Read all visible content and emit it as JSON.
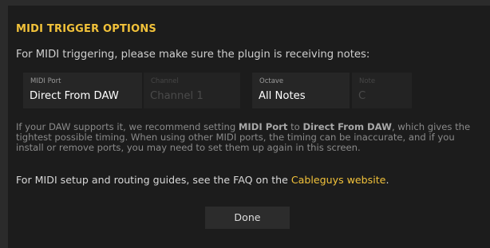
{
  "dialog": {
    "title": "MIDI TRIGGER OPTIONS",
    "intro": "For MIDI triggering, please make sure the plugin is receiving notes:"
  },
  "fields": {
    "midi_port": {
      "label": "MIDI Port",
      "value": "Direct From DAW"
    },
    "channel": {
      "label": "Channel",
      "value": "Channel 1"
    },
    "octave": {
      "label": "Octave",
      "value": "All Notes"
    },
    "note": {
      "label": "Note",
      "value": "C"
    }
  },
  "info": {
    "p1": "If your DAW supports it, we recommend setting ",
    "b1": "MIDI Port",
    "p2": " to ",
    "b2": "Direct From DAW",
    "p3": ", which gives the tightest possible timing. When using other MIDI ports, the timing can be inaccurate, and if you install or remove ports, you may need to set them up again in this screen."
  },
  "setup": {
    "text": "For MIDI setup and routing guides, see the FAQ on the ",
    "link": "Cableguys website",
    "suffix": "."
  },
  "done_label": "Done",
  "colors": {
    "accent": "#f2c23a",
    "dialog_bg": "#1c1c1c",
    "field_bg": "#262626"
  }
}
